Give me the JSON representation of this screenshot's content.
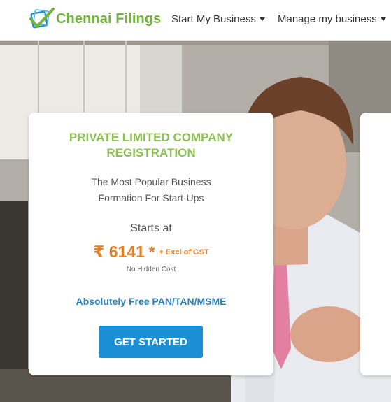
{
  "brand": {
    "name": "Chennai Filings",
    "logo_icon": "checkbox-check-logo-icon",
    "colors": {
      "green": "#72b33b",
      "blue": "#1a8fd6"
    }
  },
  "nav": {
    "items": [
      {
        "label": "Start My Business",
        "icon": "chevron-down-icon"
      },
      {
        "label": "Manage my business",
        "icon": "chevron-down-icon"
      }
    ]
  },
  "card": {
    "title": "PRIVATE LIMITED COMPANY REGISTRATION",
    "description": "The Most Popular Business Formation For Start-Ups",
    "starts_label": "Starts at",
    "price": "₹ 6141",
    "price_star": "*",
    "price_note": "+ Excl of GST",
    "hidden_cost": "No Hidden Cost",
    "free_offer": "Absolutely Free PAN/TAN/MSME",
    "cta_label": "GET STARTED",
    "colors": {
      "title": "#8cc152",
      "price": "#e67e22",
      "offer": "#2e86c1",
      "button": "#1a8fd6"
    }
  }
}
